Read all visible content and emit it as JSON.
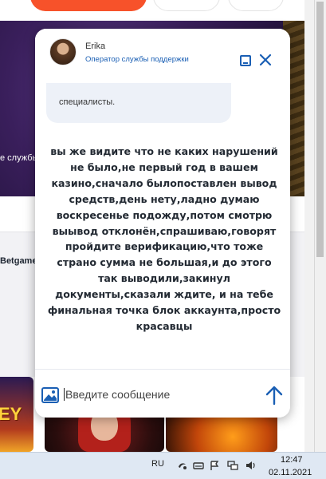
{
  "background_page": {
    "banner_text": "е службы",
    "section_text": "Betgames",
    "tile_text": "EY"
  },
  "chat": {
    "agent": {
      "name": "Erika",
      "role": "Оператор службы поддержки"
    },
    "agent_bubble_text": "специалисты.",
    "user_message": "вы же видите что не каких нарушений\nне было,не первый год  в вашем\nказино,сначало былопоставлен вывод\nсредств,день нету,ладно думаю\nвоскресенье подожду,потом смотрю\nвыывод отклонён,спрашиваю,говорят\nпройдите верификацию,что тоже\nстрано сумма не большая,и до этого\nтак выводили,закинул\nдокументы,сказали ждите, и на тебе\nфинальная точка блок аккаунта,просто\nкрасавцы",
    "input": {
      "placeholder": "Введите сообщение",
      "value": ""
    },
    "icons": {
      "minimize": "minimize-icon",
      "close": "close-icon",
      "attach": "image-icon",
      "send": "send-arrow-icon"
    },
    "colors": {
      "accent": "#1a5fb4",
      "bubble_bg": "#edf1f8",
      "text": "#232a33"
    }
  },
  "taskbar": {
    "language": "RU",
    "time": "12:47",
    "date": "02.11.2021"
  }
}
